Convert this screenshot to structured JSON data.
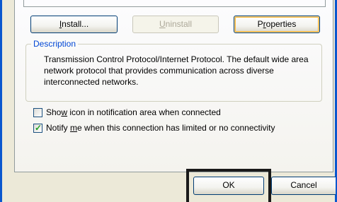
{
  "buttons": {
    "install_pre": "",
    "install_key": "I",
    "install_post": "nstall...",
    "uninstall_pre": "",
    "uninstall_key": "U",
    "uninstall_post": "ninstall",
    "properties_pre": "P",
    "properties_key": "r",
    "properties_post": "operties"
  },
  "description": {
    "legend": "Description",
    "text": "Transmission Control Protocol/Internet Protocol. The default wide area network protocol that provides communication across diverse interconnected networks."
  },
  "options": {
    "show_icon_pre": "Sho",
    "show_icon_key": "w",
    "show_icon_post": " icon in notification area when connected",
    "show_icon_checked": false,
    "notify_pre": "Notify ",
    "notify_key": "m",
    "notify_post": "e when this connection has limited or no connectivity",
    "notify_checked": true,
    "check_mark": "✓"
  },
  "footer": {
    "ok_label": "OK",
    "cancel_label": "Cancel"
  }
}
